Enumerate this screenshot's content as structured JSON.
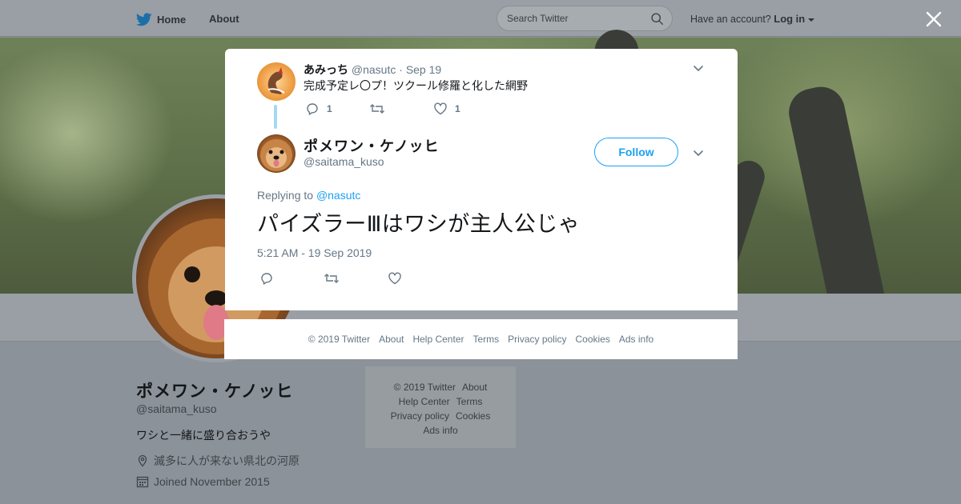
{
  "topbar": {
    "home_label": "Home",
    "about_label": "About",
    "search_placeholder": "Search Twitter",
    "account_prompt": "Have an account?",
    "login_label": "Log in"
  },
  "profile": {
    "name": "ポメワン・ケノッヒ",
    "handle": "@saitama_kuso",
    "bio": "ワシと一緒に盛り合おうや",
    "location": "滅多に人が来ない県北の河原",
    "joined": "Joined November 2015"
  },
  "side_footer": {
    "copyright": "© 2019 Twitter",
    "about": "About",
    "help": "Help Center",
    "terms": "Terms",
    "privacy": "Privacy policy",
    "cookies": "Cookies",
    "ads": "Ads info"
  },
  "parent_tweet": {
    "name": "あみっち",
    "handle": "@nasutc",
    "separator": "·",
    "date": "Sep 19",
    "text": "完成予定レ〇プ！ツクール修羅と化した網野",
    "reply_count": "1",
    "like_count": "1"
  },
  "main_tweet": {
    "name": "ポメワン・ケノッヒ",
    "handle": "@saitama_kuso",
    "follow_label": "Follow",
    "replying_prefix": "Replying to",
    "replying_to": "@nasutc",
    "text": "パイズラーⅢはワシが主人公じゃ",
    "timestamp": "5:21 AM - 19 Sep 2019"
  },
  "modal_footer": {
    "copyright": "© 2019 Twitter",
    "about": "About",
    "help": "Help Center",
    "terms": "Terms",
    "privacy": "Privacy policy",
    "cookies": "Cookies",
    "ads": "Ads info"
  },
  "colors": {
    "accent": "#1da1f2",
    "muted": "#657786",
    "thread_line": "#a4d9f5",
    "overlay": "#8c9299"
  },
  "icons": [
    "twitter-bird-icon",
    "home-icon",
    "search-icon",
    "close-icon",
    "reply-icon",
    "retweet-icon",
    "like-icon",
    "chevron-down-icon",
    "location-icon",
    "calendar-icon"
  ]
}
